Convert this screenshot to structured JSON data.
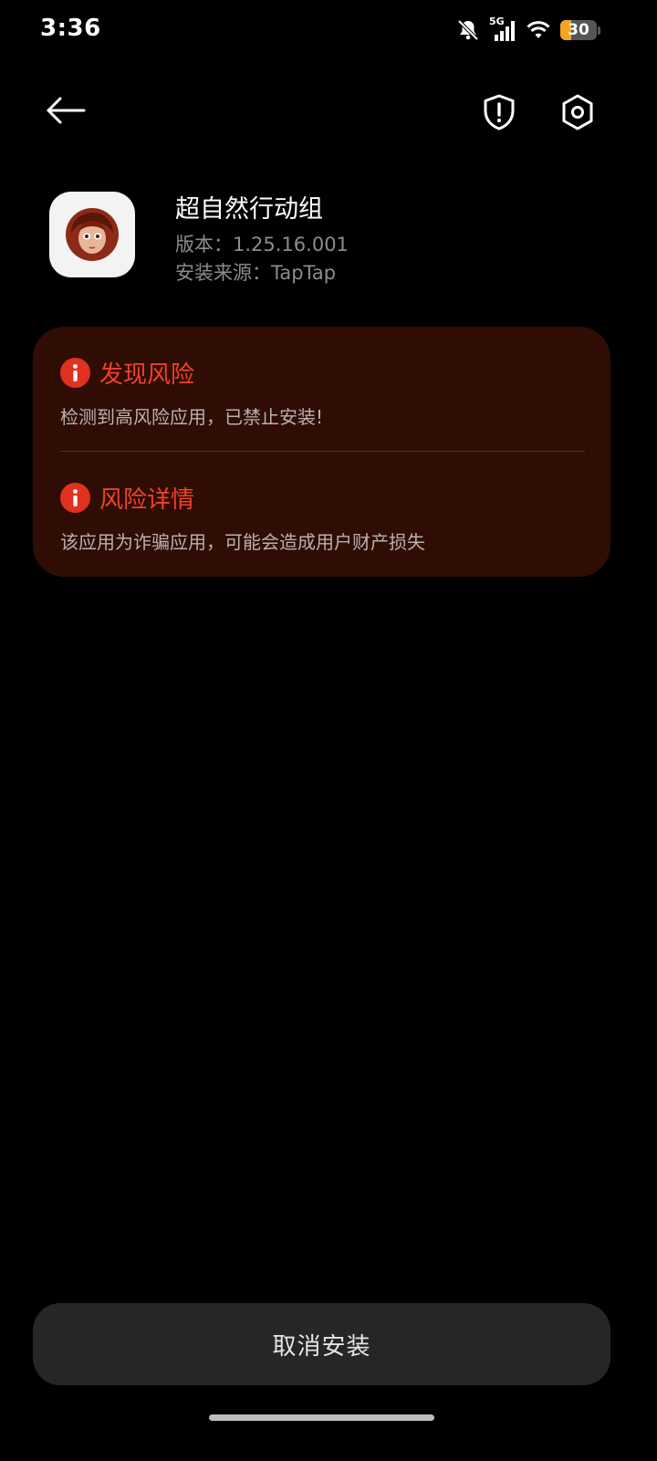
{
  "status_bar": {
    "time": "3:36",
    "network": "5G",
    "battery_level": "30",
    "battery_fraction": 0.3
  },
  "nav": {
    "back_icon": "arrow-left-icon",
    "shield_icon": "shield-alert-icon",
    "settings_icon": "hex-gear-icon"
  },
  "app": {
    "name": "超自然行动组",
    "version": "版本：1.25.16.001",
    "source": "安装来源：TapTap"
  },
  "risk": {
    "sections": [
      {
        "title": "发现风险",
        "text": "检测到高风险应用，已禁止安装!"
      },
      {
        "title": "风险详情",
        "text": "该应用为诈骗应用，可能会造成用户财产损失"
      }
    ]
  },
  "actions": {
    "cancel_label": "取消安装"
  },
  "colors": {
    "background": "#000000",
    "card": "#2f0d04",
    "risk_red": "#e0321f",
    "button": "#262626",
    "battery": "#f4a623"
  }
}
